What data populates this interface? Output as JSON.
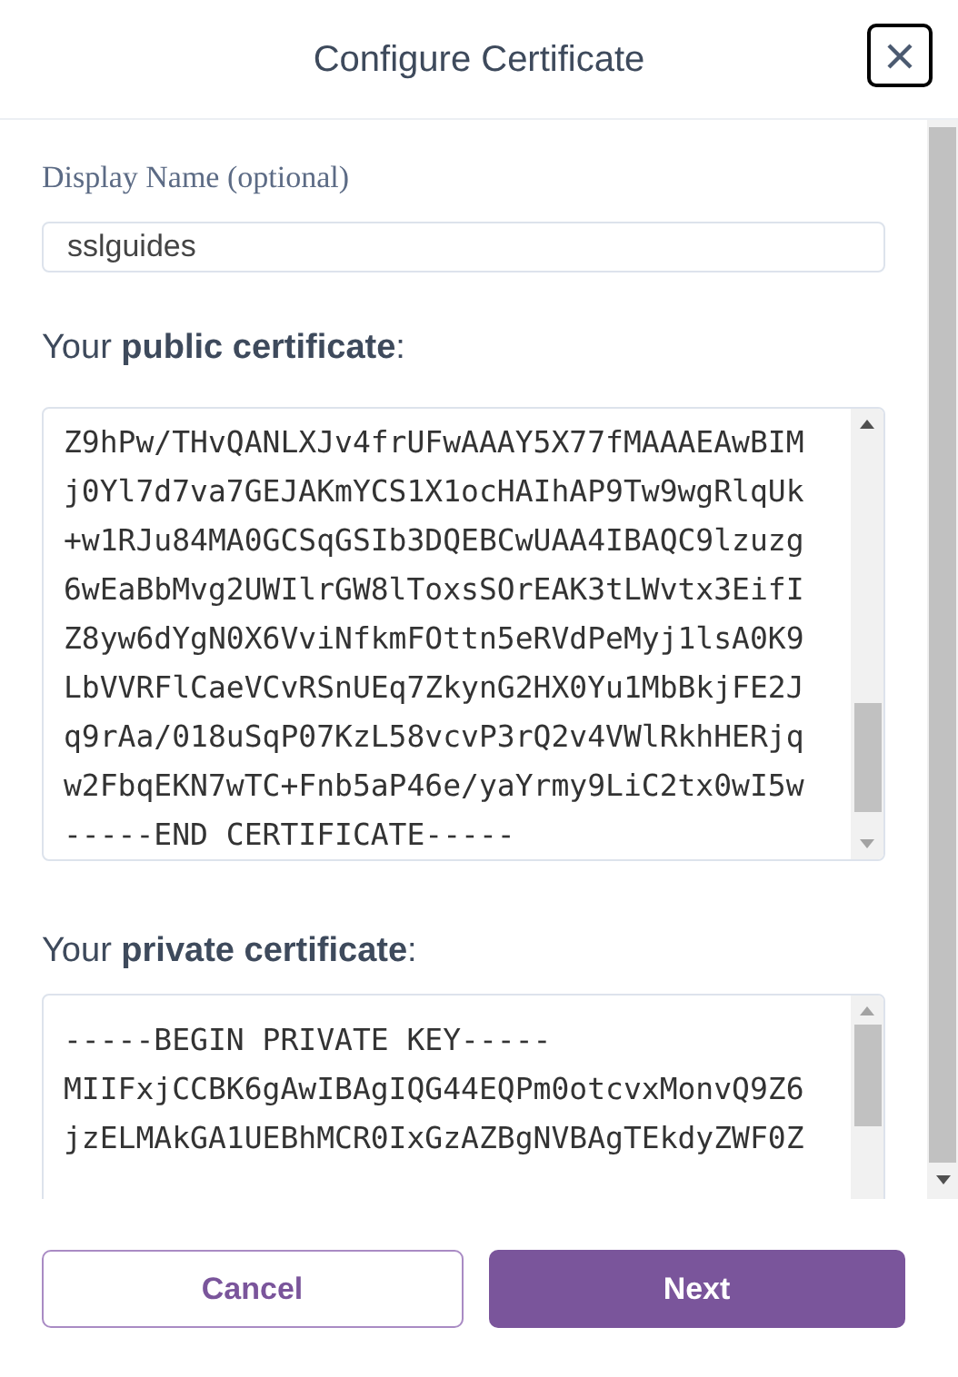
{
  "dialog": {
    "title": "Configure Certificate"
  },
  "display_name": {
    "label": "Display Name (optional)",
    "value": "sslguides"
  },
  "public_certificate": {
    "label": "Your **public certificate**:",
    "lines": [
      "Z9hPw/THvQANLXJv4frUFwAAAY5X77fMAAAEAwBIM",
      "j0Yl7d7va7GEJAKmYCS1X1ocHAIhAP9Tw9wgRlqUk",
      "+w1RJu84MA0GCSqGSIb3DQEBCwUAA4IBAQC9lzuzg",
      "6wEaBbMvg2UWIlrGW8lToxsSOrEAK3tLWvtx3EifI",
      "Z8yw6dYgN0X6VviNfkmFOttn5eRVdPeMyj1lsA0K9",
      "LbVVRFlCaeVCvRSnUEq7ZkynG2HX0Yu1MbBkjFE2J",
      "q9rAa/018uSqP07KzL58vcvP3rQ2v4VWlRkhHERjq",
      "w2FbqEKN7wTC+Fnb5aP46e/yaYrmy9LiC2tx0wI5w",
      "-----END CERTIFICATE-----"
    ]
  },
  "private_certificate": {
    "label": "Your **private certificate**:",
    "lines": [
      "-----BEGIN PRIVATE KEY-----",
      "MIIFxjCCBK6gAwIBAgIQG44EQPm0otcvxMonvQ9Z6",
      "jzELMAkGA1UEBhMCR0IxGzAZBgNVBAgTEkdyZWF0Z"
    ]
  },
  "buttons": [
    {
      "label": "Cancel",
      "kind": "secondary"
    },
    {
      "label": "Next",
      "kind": "primary"
    }
  ]
}
